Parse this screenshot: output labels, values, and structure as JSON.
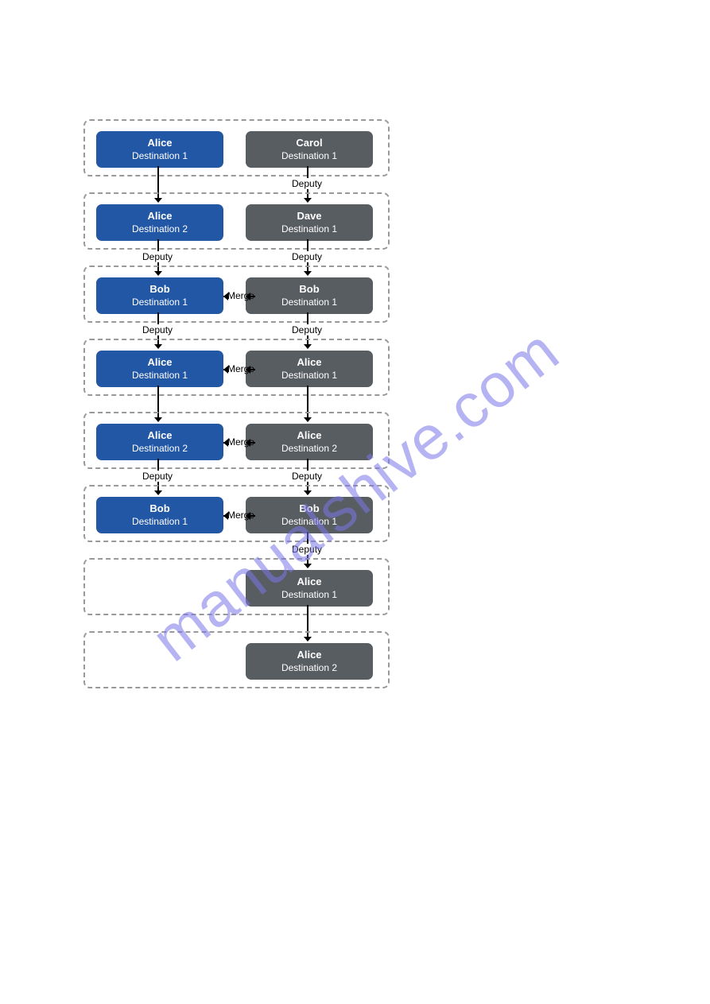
{
  "watermark": "manualshive.com",
  "labels": {
    "deputy": "Deputy",
    "merge": "Merge"
  },
  "rows": [
    {
      "left": {
        "name": "Alice",
        "dest": "Destination 1",
        "cls": "blue"
      },
      "right": {
        "name": "Carol",
        "dest": "Destination 1",
        "cls": "gray"
      },
      "arrowLeft": null,
      "arrowRight": "deputy",
      "merge": false
    },
    {
      "left": {
        "name": "Alice",
        "dest": "Destination 2",
        "cls": "blue"
      },
      "right": {
        "name": "Dave",
        "dest": "Destination 1",
        "cls": "gray"
      },
      "arrowLeft": "deputy",
      "arrowRight": "deputy",
      "merge": false
    },
    {
      "left": {
        "name": "Bob",
        "dest": "Destination 1",
        "cls": "blue"
      },
      "right": {
        "name": "Bob",
        "dest": "Destination 1",
        "cls": "gray"
      },
      "arrowLeft": "deputy",
      "arrowRight": "deputy",
      "merge": true
    },
    {
      "left": {
        "name": "Alice",
        "dest": "Destination 1",
        "cls": "blue"
      },
      "right": {
        "name": "Alice",
        "dest": "Destination 1",
        "cls": "gray"
      },
      "arrowLeft": null,
      "arrowRight": null,
      "merge": true
    },
    {
      "left": {
        "name": "Alice",
        "dest": "Destination 2",
        "cls": "blue"
      },
      "right": {
        "name": "Alice",
        "dest": "Destination 2",
        "cls": "gray"
      },
      "arrowLeft": "deputy",
      "arrowRight": "deputy",
      "merge": true
    },
    {
      "left": {
        "name": "Bob",
        "dest": "Destination 1",
        "cls": "blue"
      },
      "right": {
        "name": "Bob",
        "dest": "Destination 1",
        "cls": "gray"
      },
      "arrowLeft": null,
      "arrowRight": "deputy",
      "merge": true
    },
    {
      "left": null,
      "right": {
        "name": "Alice",
        "dest": "Destination 1",
        "cls": "gray"
      },
      "arrowLeft": null,
      "arrowRight": null,
      "merge": false
    },
    {
      "left": null,
      "right": {
        "name": "Alice",
        "dest": "Destination 2",
        "cls": "gray"
      },
      "arrowLeft": null,
      "arrowRight": null,
      "merge": false
    }
  ]
}
